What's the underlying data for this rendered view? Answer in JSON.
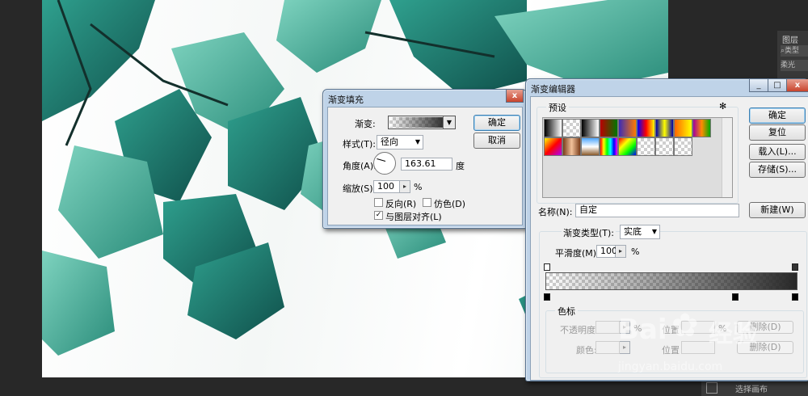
{
  "layers_panel": {
    "tab": "图层",
    "search": "类型",
    "blend": "柔光"
  },
  "gradient_fill": {
    "title": "渐变填充",
    "gradient_label": "渐变:",
    "style_label": "样式(T):",
    "style_value": "径向",
    "angle_label": "角度(A):",
    "angle_value": "163.61",
    "angle_unit": "度",
    "scale_label": "缩放(S):",
    "scale_value": "100",
    "scale_unit": "%",
    "reverse_label": "反向(R)",
    "dither_label": "仿色(D)",
    "align_label": "与图层对齐(L)",
    "ok": "确定",
    "cancel": "取消",
    "close": "x"
  },
  "gradient_editor": {
    "title": "渐变编辑器",
    "presets_label": "预设",
    "gear_icon": "gear-icon",
    "ok": "确定",
    "reset": "复位",
    "load": "载入(L)...",
    "save": "存储(S)...",
    "name_label": "名称(N):",
    "name_value": "自定",
    "new": "新建(W)",
    "type_label": "渐变类型(T):",
    "type_value": "实底",
    "smooth_label": "平滑度(M):",
    "smooth_value": "100",
    "smooth_unit": "%",
    "stops_group": "色标",
    "opacity_label": "不透明度:",
    "opacity_unit": "%",
    "location_label_1": "位置",
    "location_unit": "%",
    "delete_1": "删除(D)",
    "color_label": "颜色:",
    "location_label_2": "位置",
    "delete_2": "删除(D)",
    "min": "_",
    "max": "□",
    "close": "x"
  },
  "bottom_bar": {
    "select_canvas": "选择画布"
  },
  "watermark": {
    "brand": "Bai",
    "brand2": "经验",
    "url": "jingyan.baidu.com"
  },
  "colors": {
    "dialog_frame": "#bfd3e8",
    "dialog_body": "#f0f0f0",
    "ps_dark": "#282828",
    "leaf": "#1f7a6e"
  }
}
